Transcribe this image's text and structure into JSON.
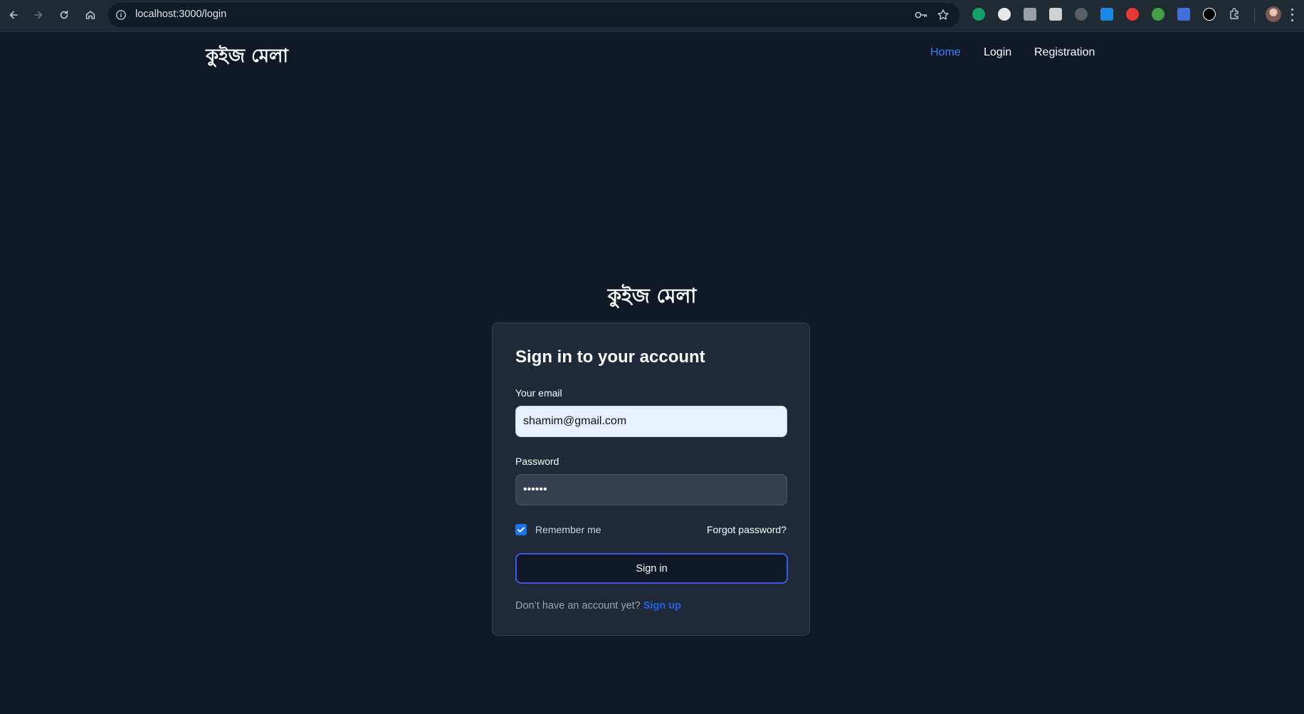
{
  "browser": {
    "url": "localhost:3000/login",
    "icons": [
      "back-icon",
      "forward-icon",
      "reload-icon",
      "home-icon",
      "site-info-icon",
      "password-key-icon",
      "bookmark-star-icon",
      "extensions-icon",
      "profile-avatar",
      "menu-icon"
    ]
  },
  "header": {
    "brand": "কুইজ মেলা",
    "nav": [
      {
        "label": "Home",
        "active": true
      },
      {
        "label": "Login",
        "active": false
      },
      {
        "label": "Registration",
        "active": false
      }
    ],
    "accent": "#3b82f6"
  },
  "login": {
    "brand": "কুইজ মেলা",
    "title": "Sign in to your account",
    "email_label": "Your email",
    "email_value": "shamim@gmail.com",
    "password_label": "Password",
    "password_value": "••••••",
    "remember_label": "Remember me",
    "remember_checked": true,
    "forgot_label": "Forgot password?",
    "signin_label": "Sign in",
    "signup_prompt": "Don’t have an account yet?",
    "signup_link": "Sign up"
  },
  "colors": {
    "page_bg": "#111827",
    "card_bg": "#1f2937",
    "link": "#2563eb"
  }
}
